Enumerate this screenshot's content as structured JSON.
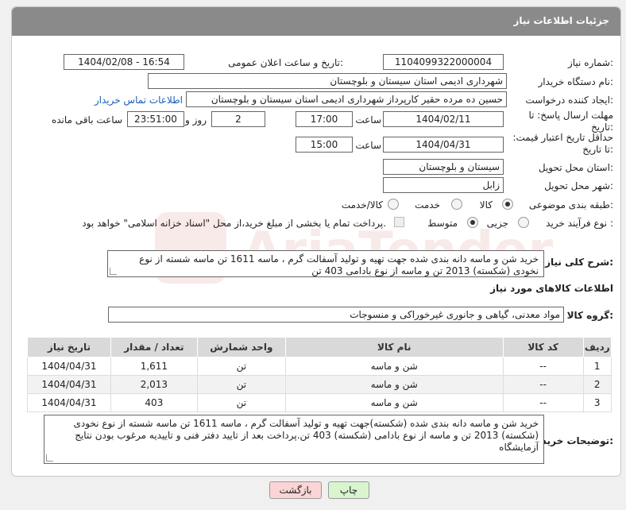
{
  "panel": {
    "title": "جزئیات اطلاعات نیاز"
  },
  "fields": {
    "need_number_label": "شماره نیاز:",
    "need_number": "1104099322000004",
    "announce_label": "تاریخ و ساعت اعلان عمومی:",
    "announce_value": "1404/02/08 - 16:54",
    "buyer_org_label": "نام دستگاه خریدار:",
    "buyer_org": "شهرداری ادیمی استان سیستان و بلوچستان",
    "creator_label": "ایجاد کننده درخواست:",
    "creator": "حسین ده مرده حقیر کارپرداز شهرداری ادیمی استان سیستان و بلوچستان",
    "contact_link": "اطلاعات تماس خریدار",
    "reply_deadline_label": "مهلت ارسال پاسخ: تا تاریخ:",
    "reply_date": "1404/02/11",
    "time_label": "ساعت",
    "reply_time": "17:00",
    "days_value": "2",
    "days_label": "روز و",
    "remaining_time": "23:51:00",
    "remaining_label": "ساعت باقی مانده",
    "validity_label": "حداقل تاریخ اعتبار قیمت: تا تاریخ:",
    "validity_date": "1404/04/31",
    "validity_time": "15:00",
    "province_label": "استان محل تحویل:",
    "province": "سیستان و بلوچستان",
    "city_label": "شهر محل تحویل:",
    "city": "زابل",
    "category_label": "طبقه بندی موضوعی:",
    "category_options": [
      "کالا",
      "خدمت",
      "کالا/خدمت"
    ],
    "process_label": "نوع فرآیند خرید :",
    "process_options": [
      "جزیی",
      "متوسط"
    ],
    "payment_note": "پرداخت تمام یا بخشی از مبلغ خرید،از محل \"اسناد خزانه اسلامی\" خواهد بود."
  },
  "description": {
    "label": "شرح کلی نیاز:",
    "text": "خرید شن و ماسه دانه بندی شده جهت تهیه و تولید آسفالت گرم ، ماسه 1611 تن ماسه شسته از نوع نخودی (شکسته) 2013 تن و ماسه از نوع بادامی 403 تن"
  },
  "goods_section": {
    "title": "اطلاعات کالاهای مورد نیاز",
    "group_label": "گروه کالا:",
    "group_value": "مواد معدنی، گیاهی و جانوری غیرخوراکی و منسوجات"
  },
  "table": {
    "headers": [
      "ردیف",
      "کد کالا",
      "نام کالا",
      "واحد شمارش",
      "تعداد / مقدار",
      "تاریخ نیاز"
    ],
    "rows": [
      [
        "1",
        "--",
        "شن و ماسه",
        "تن",
        "1,611",
        "1404/04/31"
      ],
      [
        "2",
        "--",
        "شن و ماسه",
        "تن",
        "2,013",
        "1404/04/31"
      ],
      [
        "3",
        "--",
        "شن و ماسه",
        "تن",
        "403",
        "1404/04/31"
      ]
    ]
  },
  "buyer_notes": {
    "label": "توضیحات خریدار:",
    "text": "خرید شن و ماسه دانه بندی شده (شکسته)جهت تهیه و تولید آسفالت گرم ، ماسه 1611 تن ماسه شسته از نوع نخودی (شکسته) 2013 تن و ماسه از نوع بادامی (شکسته) 403 تن.پرداخت بعد از تایید دفتر فنی و تاییدیه مرغوب بودن نتایج آزمایشگاه"
  },
  "buttons": {
    "print": "چاپ",
    "back": "بازگشت"
  },
  "colors": {
    "header": "#8a8a8a",
    "link": "#1a5fb4",
    "print_bg": "#d9f5d0",
    "back_bg": "#fbd5d5"
  }
}
